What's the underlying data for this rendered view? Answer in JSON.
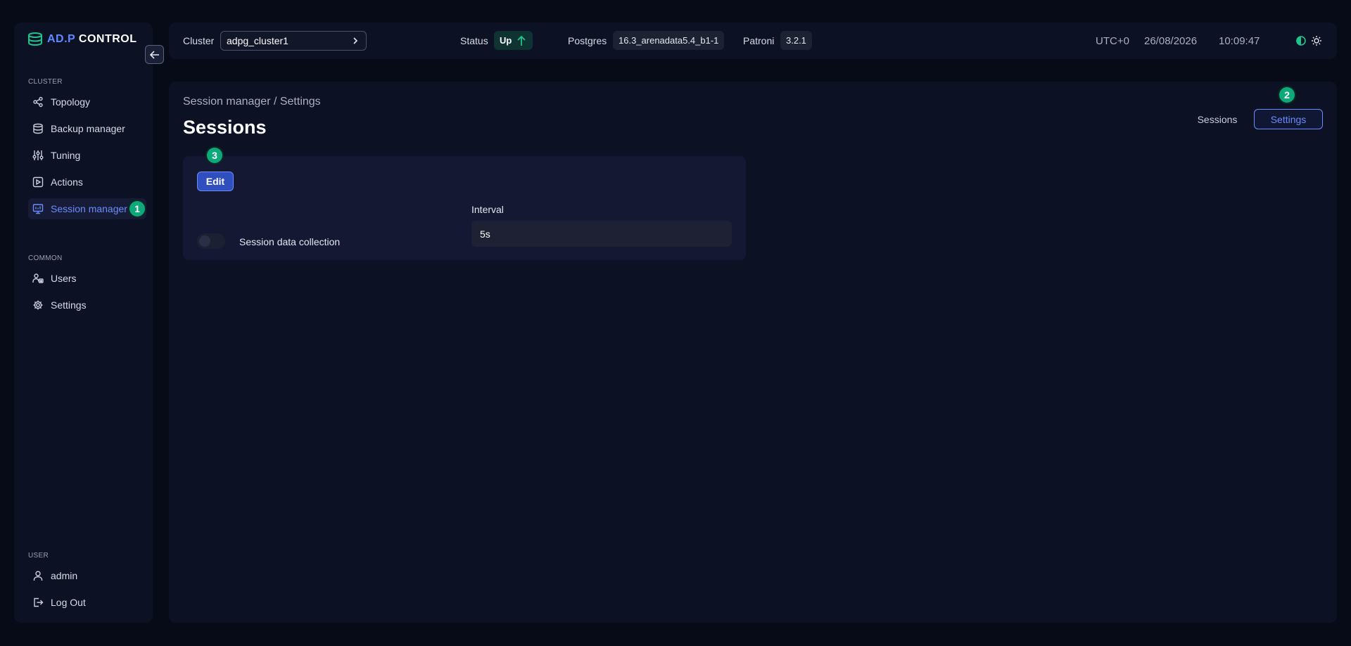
{
  "logo": {
    "prefix": "AD.P",
    "suffix": "CONTROL"
  },
  "sidebar": {
    "sections": {
      "cluster": "CLUSTER",
      "common": "COMMON",
      "user": "USER"
    },
    "cluster_items": [
      {
        "label": "Topology",
        "icon": "topology-icon"
      },
      {
        "label": "Backup manager",
        "icon": "database-icon"
      },
      {
        "label": "Tuning",
        "icon": "sliders-icon"
      },
      {
        "label": "Actions",
        "icon": "play-square-icon"
      },
      {
        "label": "Session manager",
        "icon": "monitor-icon",
        "active": true
      }
    ],
    "common_items": [
      {
        "label": "Users",
        "icon": "users-icon"
      },
      {
        "label": "Settings",
        "icon": "gear-icon"
      }
    ],
    "user_items": [
      {
        "label": "admin",
        "icon": "user-icon"
      },
      {
        "label": "Log Out",
        "icon": "logout-icon"
      }
    ]
  },
  "topbar": {
    "cluster_label": "Cluster",
    "cluster_value": "adpg_cluster1",
    "status_label": "Status",
    "status_value": "Up",
    "postgres_label": "Postgres",
    "postgres_value": "16.3_arenadata5.4_b1-1",
    "patroni_label": "Patroni",
    "patroni_value": "3.2.1",
    "timezone": "UTC+0",
    "date": "26/08/2026",
    "time": "10:09:47"
  },
  "main": {
    "breadcrumb": "Session manager / Settings",
    "title": "Sessions",
    "tabs": [
      {
        "label": "Sessions",
        "selected": false
      },
      {
        "label": "Settings",
        "selected": true
      }
    ],
    "edit_label": "Edit",
    "toggle_label": "Session data collection",
    "toggle_on": false,
    "interval_label": "Interval",
    "interval_value": "5s"
  },
  "badges": [
    "1",
    "2",
    "3"
  ],
  "colors": {
    "accent": "#6d8bff",
    "status_up": "#0ea97a",
    "badge": "#0ea97a"
  }
}
